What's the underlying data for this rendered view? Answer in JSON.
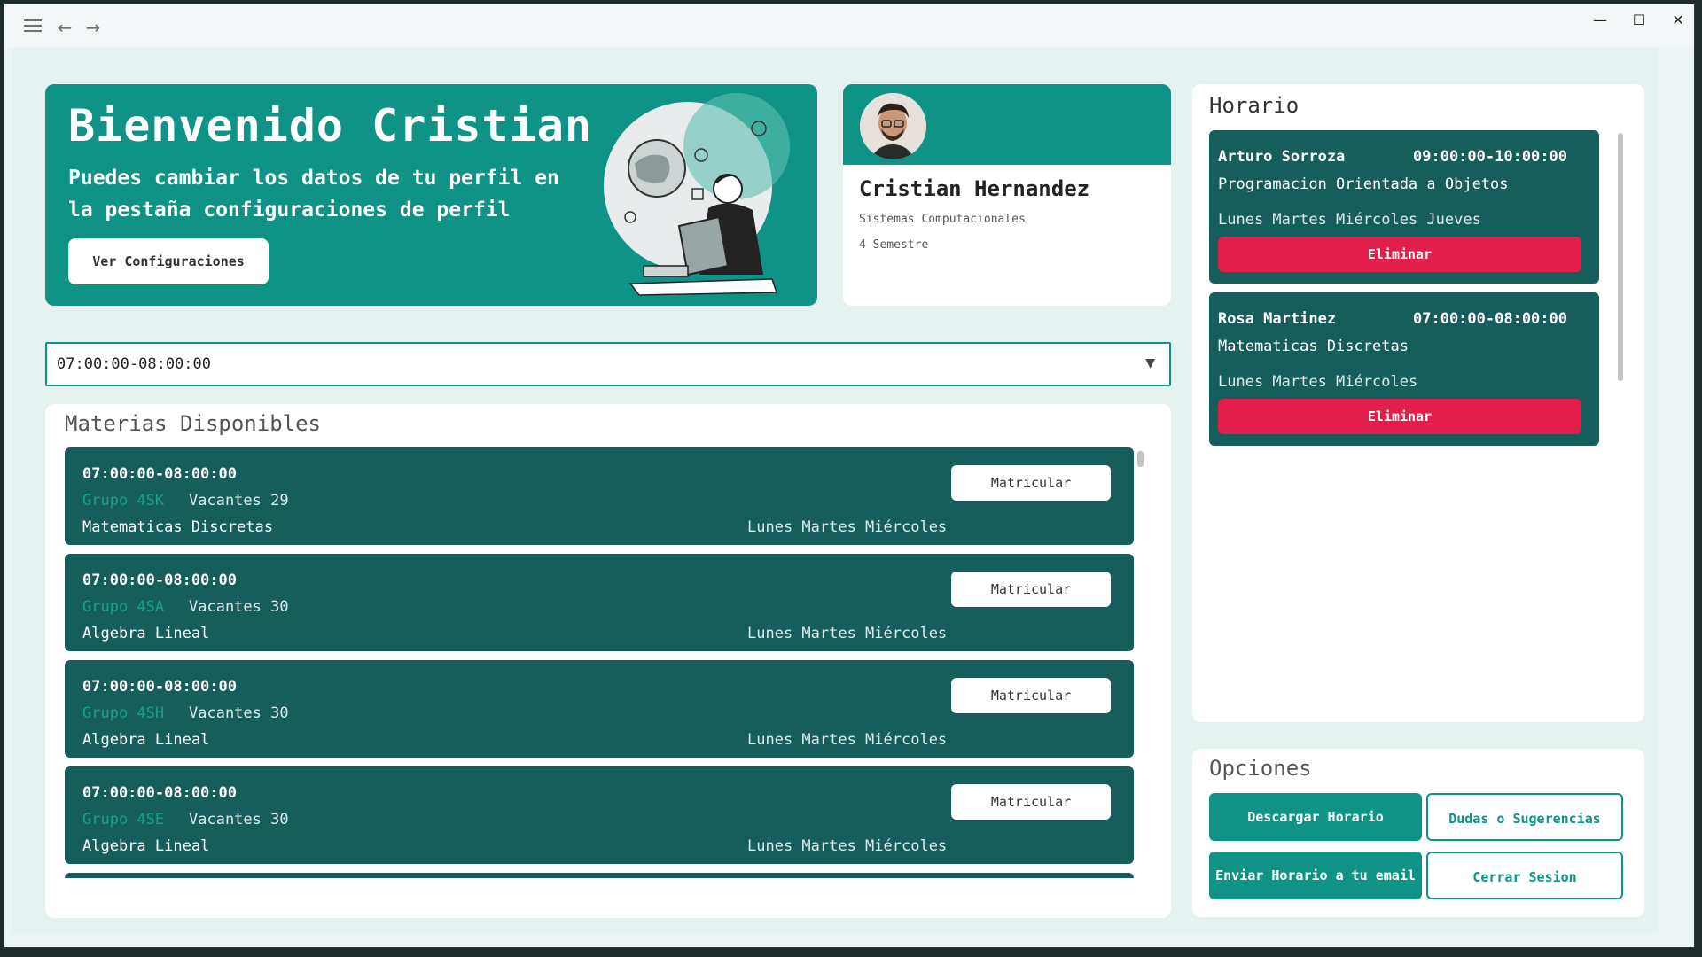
{
  "window": {
    "menu_icon": "hamburger-icon",
    "back_icon": "arrow-left-icon",
    "forward_icon": "arrow-right-icon"
  },
  "welcome": {
    "title": "Bienvenido Cristian",
    "subtitle": "Puedes cambiar los datos de tu perfil en la pestaña configuraciones de perfil",
    "button": "Ver Configuraciones"
  },
  "profile": {
    "name": "Cristian Hernandez",
    "career": "Sistemas Computacionales",
    "semester": "4 Semestre"
  },
  "filter": {
    "selected": "07:00:00-08:00:00"
  },
  "materias": {
    "title": "Materias Disponibles",
    "enroll_label": "Matricular",
    "items": [
      {
        "time": "07:00:00-08:00:00",
        "group": "Grupo 4SK",
        "vacancies": "Vacantes 29",
        "subject": "Matematicas Discretas",
        "days": "Lunes Martes Miércoles"
      },
      {
        "time": "07:00:00-08:00:00",
        "group": "Grupo 4SA",
        "vacancies": "Vacantes 30",
        "subject": "Algebra Lineal",
        "days": "Lunes Martes Miércoles"
      },
      {
        "time": "07:00:00-08:00:00",
        "group": "Grupo 4SH",
        "vacancies": "Vacantes 30",
        "subject": "Algebra Lineal",
        "days": "Lunes Martes Miércoles"
      },
      {
        "time": "07:00:00-08:00:00",
        "group": "Grupo 4SE",
        "vacancies": "Vacantes 30",
        "subject": "Algebra Lineal",
        "days": "Lunes Martes Miércoles"
      }
    ]
  },
  "horario": {
    "title": "Horario",
    "delete_label": "Eliminar",
    "items": [
      {
        "teacher": "Arturo Sorroza",
        "time": "09:00:00-10:00:00",
        "subject": "Programacion Orientada a Objetos",
        "days": "Lunes Martes Miércoles Jueves"
      },
      {
        "teacher": "Rosa Martinez",
        "time": "07:00:00-08:00:00",
        "subject": "Matematicas Discretas",
        "days": "Lunes Martes Miércoles"
      }
    ]
  },
  "opciones": {
    "title": "Opciones",
    "download": "Descargar Horario",
    "questions": "Dudas o Sugerencias",
    "email": "Enviar Horario a tu email",
    "logout": "Cerrar Sesion"
  },
  "colors": {
    "primary": "#0e9386",
    "card": "#165e5b",
    "danger": "#e11f4a"
  }
}
